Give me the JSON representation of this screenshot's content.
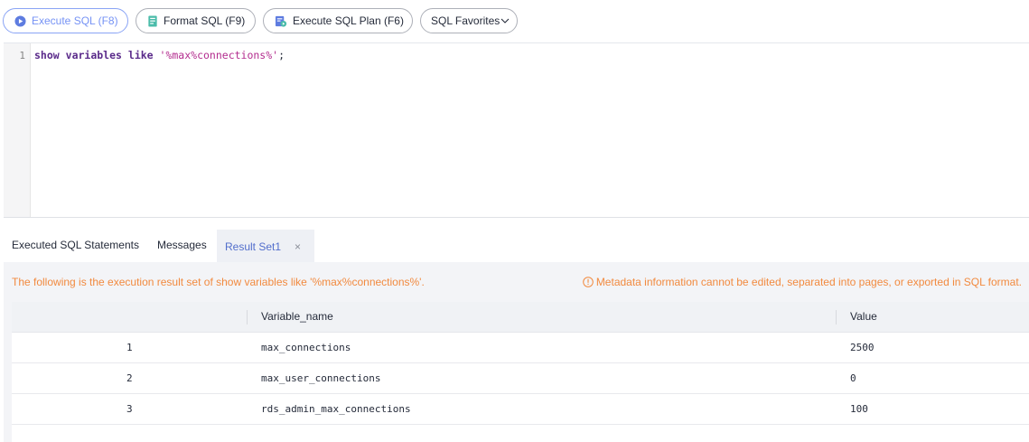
{
  "toolbar": {
    "execute_sql": "Execute SQL (F8)",
    "format_sql": "Format SQL (F9)",
    "execute_sql_plan": "Execute SQL Plan (F6)",
    "sql_favorites": "SQL Favorites"
  },
  "editor": {
    "line_number": "1",
    "code": {
      "kw1": "show",
      "kw2": "variables",
      "kw3": "like",
      "string": "'%max%connections%'",
      "end": ";"
    }
  },
  "tabs": {
    "executed": "Executed SQL Statements",
    "messages": "Messages",
    "result": "Result Set1",
    "close": "×"
  },
  "result": {
    "info": "The following is the execution result set of show variables like '%max%connections%'.",
    "warning": "Metadata information cannot be edited, separated into pages, or exported in SQL format.",
    "columns": [
      "",
      "Variable_name",
      "Value"
    ],
    "rows": [
      {
        "idx": "1",
        "name": "max_connections",
        "value": "2500"
      },
      {
        "idx": "2",
        "name": "max_user_connections",
        "value": "0"
      },
      {
        "idx": "3",
        "name": "rds_admin_max_connections",
        "value": "100"
      }
    ]
  },
  "colors": {
    "accent": "#526ecc",
    "warning": "#f28a3f"
  },
  "icons": {
    "execute": "play-circle-icon",
    "format": "document-icon",
    "plan": "plan-icon",
    "favorites": "chevron-down-icon",
    "warning": "info-circle-icon",
    "close": "close-icon"
  }
}
